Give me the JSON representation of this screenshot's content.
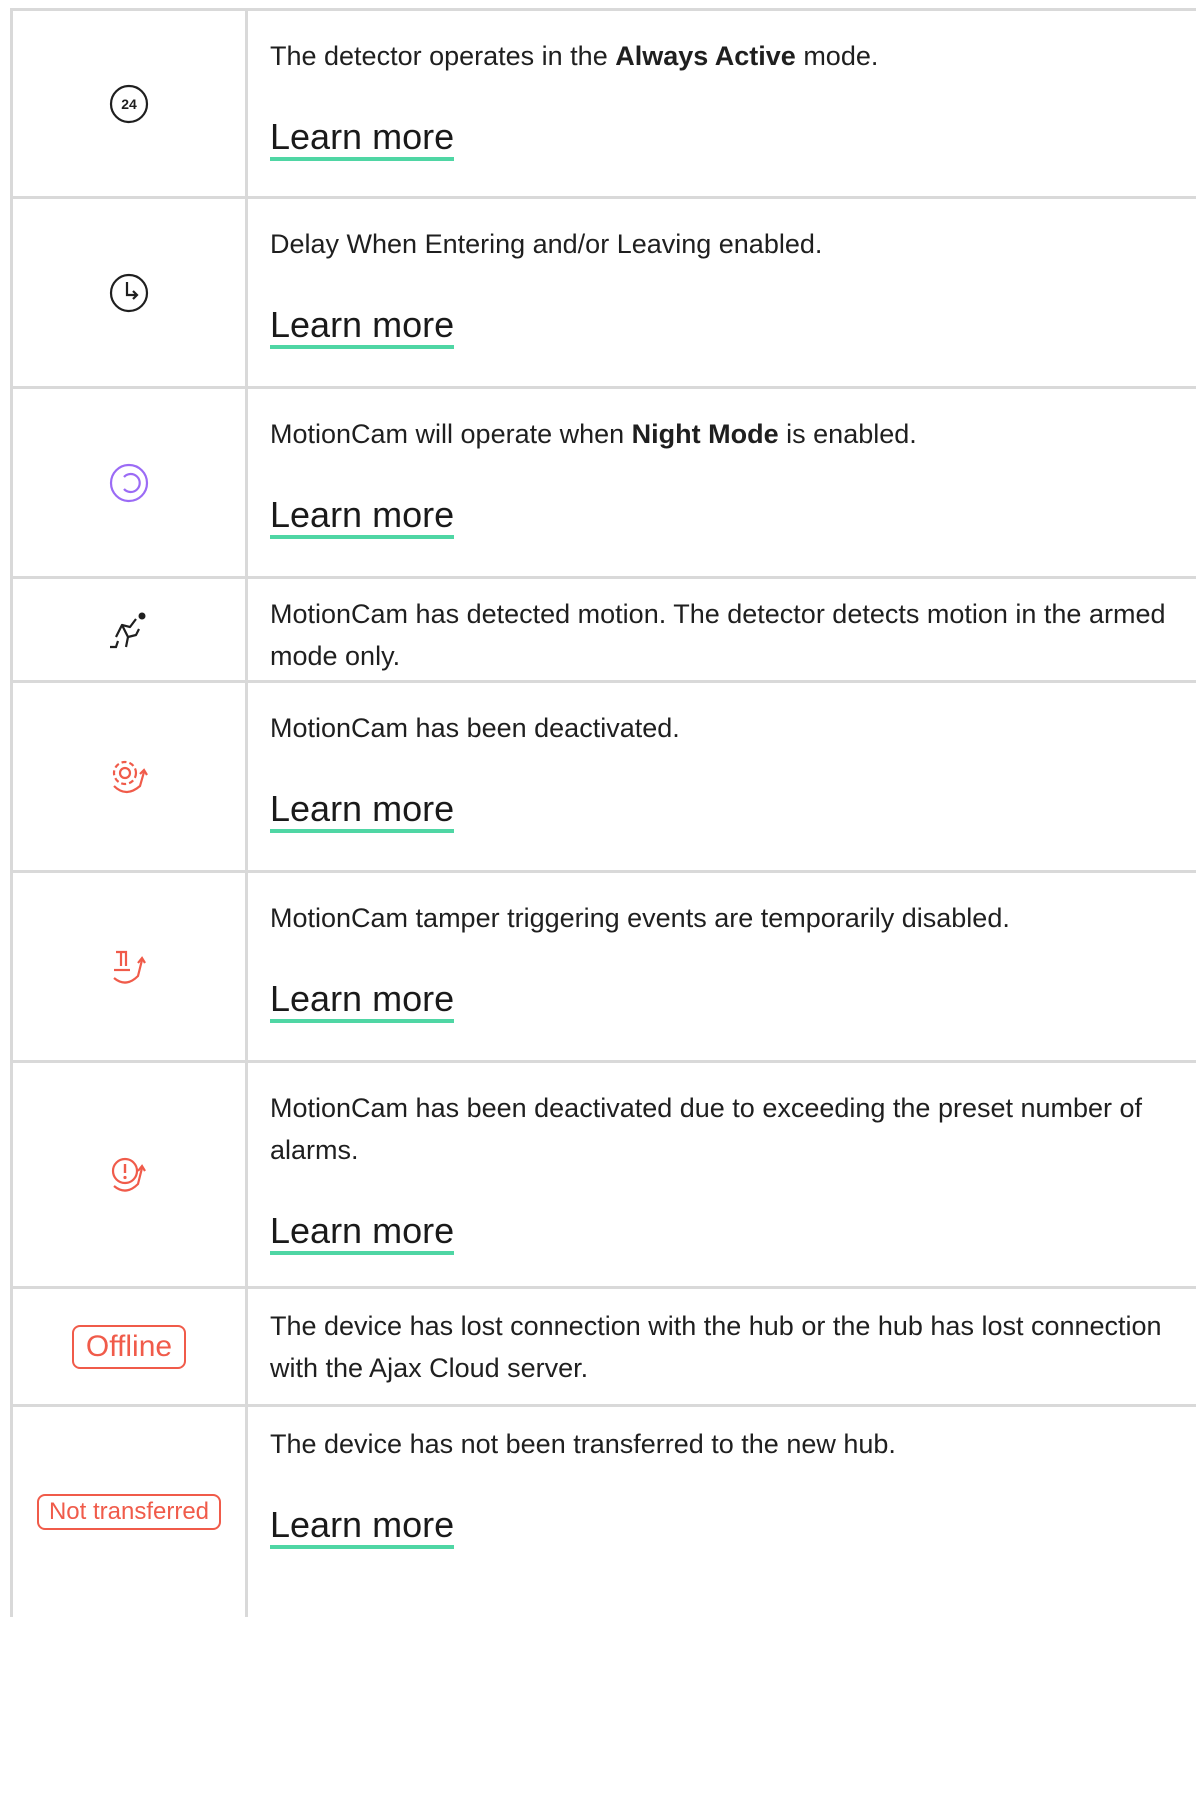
{
  "learn_more": "Learn more",
  "colors": {
    "border": "#d9d9d9",
    "accent_underline": "#4fd6a4",
    "alert_red": "#f05b4a",
    "night_purple": "#9b6bf5"
  },
  "rows": [
    {
      "icon": "always-active-24-icon",
      "icon_text": "24",
      "text_before": "The detector operates in the ",
      "text_bold": "Always Active",
      "text_after": " mode.",
      "has_link": true
    },
    {
      "icon": "delay-clock-icon",
      "text": "Delay When Entering and/or Leaving enabled.",
      "has_link": true
    },
    {
      "icon": "night-mode-icon",
      "text_before": "MotionCam will operate when ",
      "text_bold": "Night Mode",
      "text_after": " is enabled.",
      "has_link": true
    },
    {
      "icon": "motion-detected-icon",
      "text": "MotionCam has detected motion. The detector detects motion in the armed mode only.",
      "has_link": false
    },
    {
      "icon": "deactivated-gear-icon",
      "text": "MotionCam has been deactivated.",
      "has_link": true
    },
    {
      "icon": "tamper-disabled-icon",
      "text": "MotionCam tamper triggering events are temporarily disabled.",
      "has_link": true
    },
    {
      "icon": "alarm-limit-deactivated-icon",
      "text": "MotionCam has been deactivated due to exceeding the preset number of alarms.",
      "has_link": true
    },
    {
      "badge": "Offline",
      "text": "The device has lost connection with the hub or the hub has lost connection with the Ajax Cloud server.",
      "has_link": false
    },
    {
      "badge": "Not transferred",
      "text": "The device has not been transferred to the new hub.",
      "has_link": true
    }
  ]
}
